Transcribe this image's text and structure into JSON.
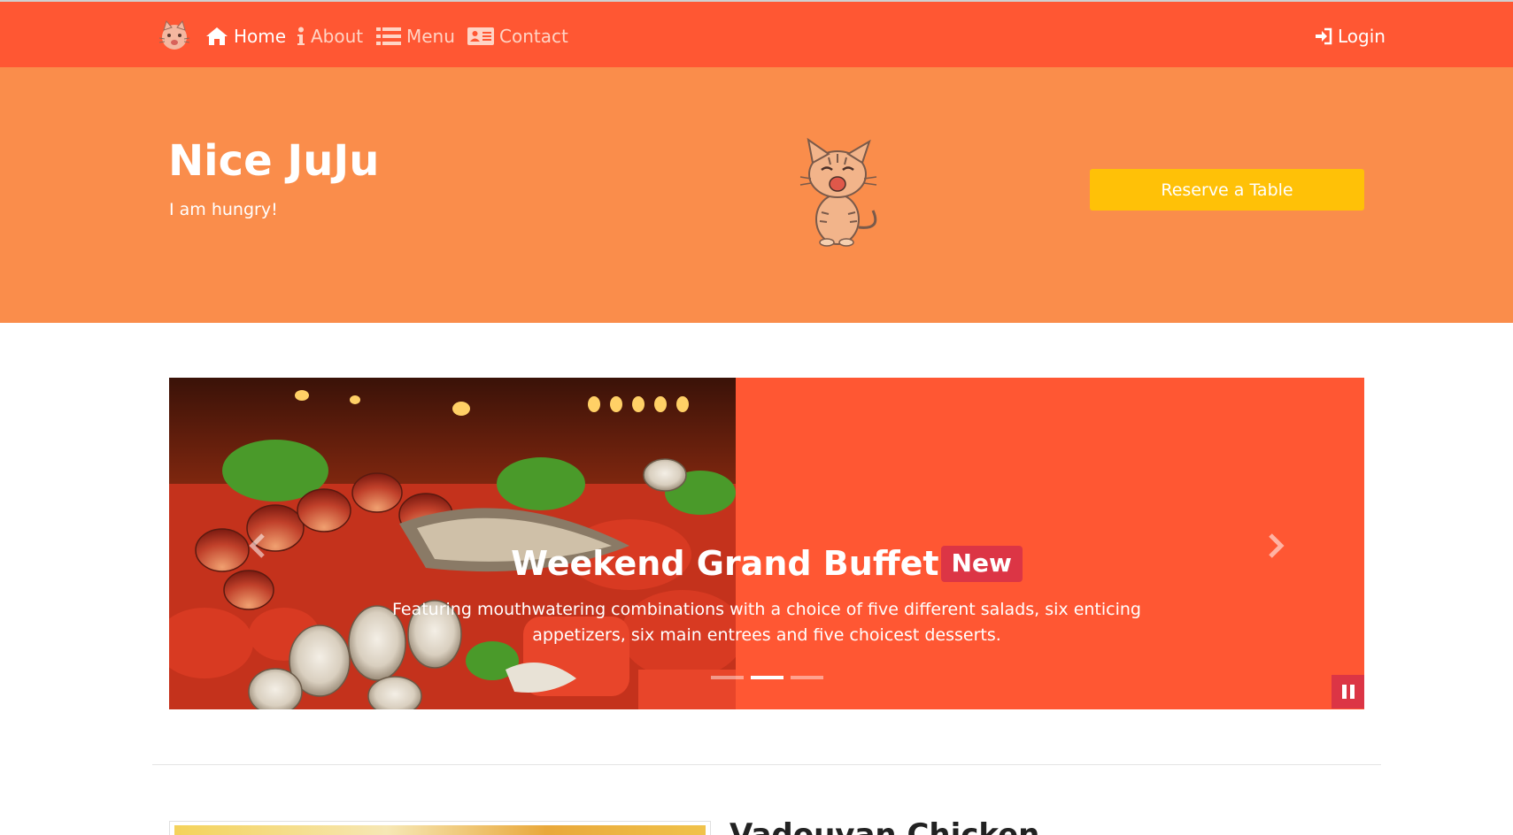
{
  "navbar": {
    "brand_icon": "kitten-logo",
    "items": [
      {
        "label": "Home",
        "icon": "home-icon",
        "active": true
      },
      {
        "label": "About",
        "icon": "info-icon",
        "active": false
      },
      {
        "label": "Menu",
        "icon": "list-icon",
        "active": false
      },
      {
        "label": "Contact",
        "icon": "address-card-icon",
        "active": false
      }
    ],
    "login": {
      "label": "Login",
      "icon": "sign-in-icon"
    }
  },
  "hero": {
    "title": "Nice JuJu",
    "subtitle": "I am hungry!",
    "mascot_icon": "kitten-illustration",
    "reserve_label": "Reserve a Table"
  },
  "carousel": {
    "slide_title": "Weekend Grand Buffet",
    "badge": "New",
    "slide_text": "Featuring mouthwatering combinations with a choice of five different salads, six enticing appetizers, six main entrees and five choicest desserts.",
    "indicator_count": 3,
    "active_indicator": 1,
    "pause_icon": "pause-icon"
  },
  "next_section": {
    "heading": "Vadouvan Chicken"
  },
  "colors": {
    "navbar": "#ff5733",
    "hero": "#fa8d4b",
    "reserve_button": "#ffc107",
    "carousel_bg": "#ff5733",
    "badge": "#dc3545"
  }
}
